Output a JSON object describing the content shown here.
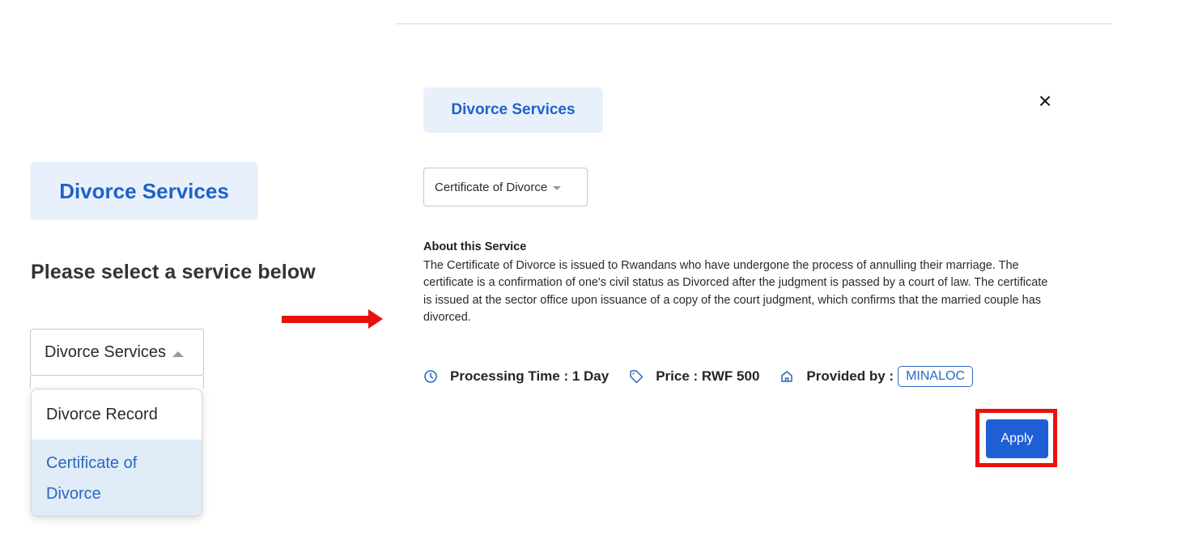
{
  "left_panel": {
    "badge_label": "Divorce Services",
    "heading": "Please select a service below",
    "select_value": "Divorce Services",
    "dropdown_options": [
      "Divorce Record",
      "Certificate of Divorce"
    ]
  },
  "modal": {
    "badge_label": "Divorce Services",
    "close_icon_glyph": "×",
    "select_value": "Certificate of Divorce",
    "about_title": "About this Service",
    "about_text": "The Certificate of Divorce is issued to Rwandans who have undergone the process of annulling their marriage. The certificate is a confirmation of one's civil status as Divorced after the judgment is passed by a court of law. The certificate is issued at the sector office upon issuance of a copy of the court judgment, which confirms that the married couple has divorced.",
    "processing_time_label": "Processing Time : 1 Day",
    "price_label": "Price : RWF 500",
    "provided_by_label": "Provided by :",
    "provider_name": "MINALOC",
    "apply_label": "Apply"
  },
  "icons": {
    "processing_time": "clock-icon",
    "price": "tag-icon",
    "provider": "home-icon",
    "close": "close-icon"
  },
  "colors": {
    "accent_blue": "#1e62c9",
    "badge_background": "#e8f1fb",
    "selected_option_background": "#e0ecf8",
    "apply_button": "#1f5fd6",
    "annotation_red": "#e8110f"
  }
}
